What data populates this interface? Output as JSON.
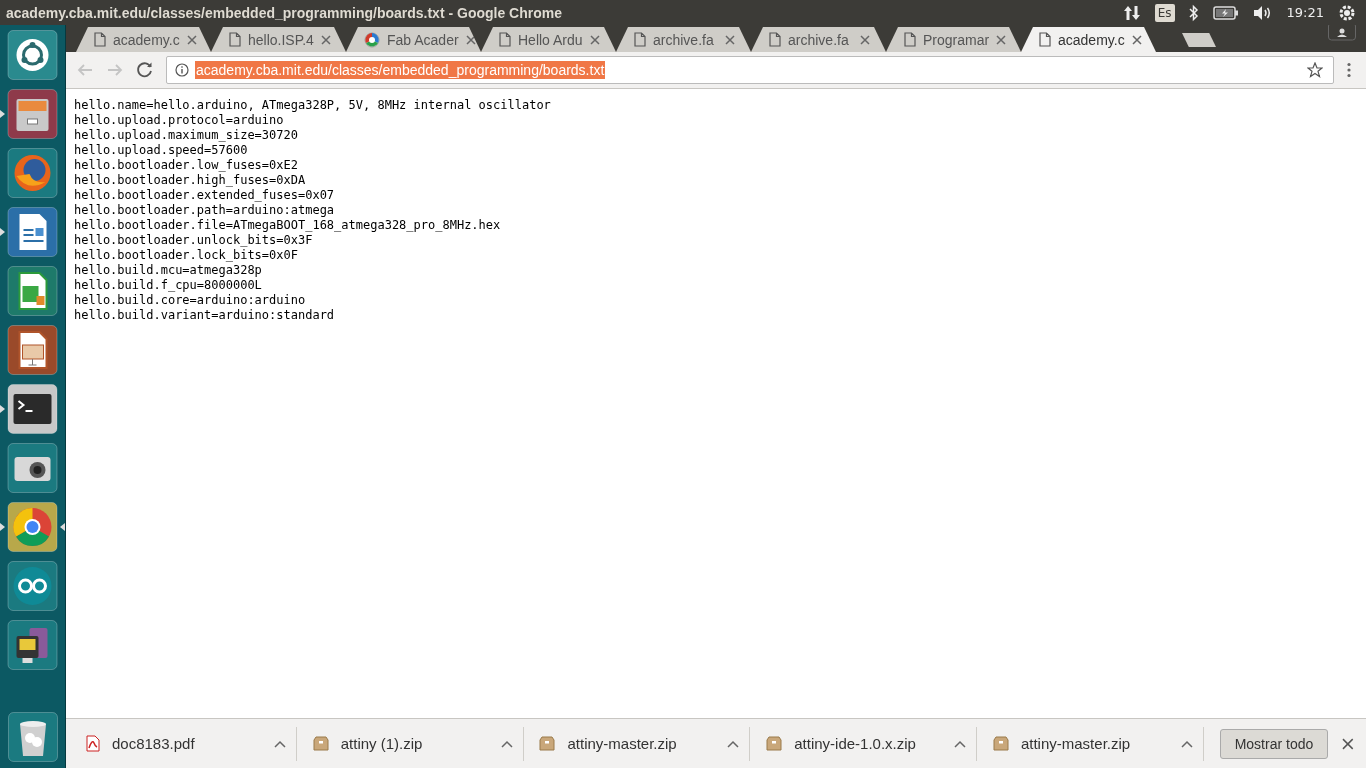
{
  "window": {
    "title": "academy.cba.mit.edu/classes/embedded_programming/boards.txt - Google Chrome"
  },
  "top_panel": {
    "keyboard_layout": "Es",
    "clock": "19:21"
  },
  "launcher": [
    {
      "kind": "dash",
      "running": false,
      "focused": false
    },
    {
      "kind": "files",
      "running": true,
      "focused": false
    },
    {
      "kind": "firefox",
      "running": false,
      "focused": false
    },
    {
      "kind": "writer",
      "running": true,
      "focused": false
    },
    {
      "kind": "calc",
      "running": false,
      "focused": false
    },
    {
      "kind": "impress",
      "running": false,
      "focused": false
    },
    {
      "kind": "terminal",
      "running": true,
      "focused": false
    },
    {
      "kind": "camera",
      "running": false,
      "focused": false
    },
    {
      "kind": "chrome",
      "running": true,
      "focused": true
    },
    {
      "kind": "arduino",
      "running": false,
      "focused": false
    },
    {
      "kind": "device",
      "running": false,
      "focused": false
    }
  ],
  "tabs": [
    {
      "title": "academy.c",
      "kind": "page",
      "selected": false
    },
    {
      "title": "hello.ISP.4",
      "kind": "page",
      "selected": false
    },
    {
      "title": "Fab Acader",
      "kind": "fab",
      "selected": false
    },
    {
      "title": "Hello Ardu",
      "kind": "page",
      "selected": false
    },
    {
      "title": "archive.fa",
      "kind": "page",
      "selected": false
    },
    {
      "title": "archive.fa",
      "kind": "page",
      "selected": false
    },
    {
      "title": "Programar",
      "kind": "page",
      "selected": false
    },
    {
      "title": "academy.c",
      "kind": "page",
      "selected": true
    }
  ],
  "toolbar": {
    "back_disabled": true,
    "forward_disabled": true,
    "url": "academy.cba.mit.edu/classes/embedded_programming/boards.txt",
    "url_selected": true
  },
  "page_lines": [
    "hello.name=hello.arduino, ATmega328P, 5V, 8MHz internal oscillator",
    "hello.upload.protocol=arduino",
    "hello.upload.maximum_size=30720",
    "hello.upload.speed=57600",
    "hello.bootloader.low_fuses=0xE2",
    "hello.bootloader.high_fuses=0xDA",
    "hello.bootloader.extended_fuses=0x07",
    "hello.bootloader.path=arduino:atmega",
    "hello.bootloader.file=ATmegaBOOT_168_atmega328_pro_8MHz.hex",
    "hello.bootloader.unlock_bits=0x3F",
    "hello.bootloader.lock_bits=0x0F",
    "hello.build.mcu=atmega328p",
    "hello.build.f_cpu=8000000L",
    "hello.build.core=arduino:arduino",
    "hello.build.variant=arduino:standard"
  ],
  "downloads": [
    {
      "name": "doc8183.pdf",
      "kind": "pdf"
    },
    {
      "name": "attiny (1).zip",
      "kind": "zip"
    },
    {
      "name": "attiny-master.zip",
      "kind": "zip"
    },
    {
      "name": "attiny-ide-1.0.x.zip",
      "kind": "zip"
    },
    {
      "name": "attiny-master.zip",
      "kind": "zip"
    }
  ],
  "download_bar": {
    "show_all": "Mostrar todo"
  }
}
